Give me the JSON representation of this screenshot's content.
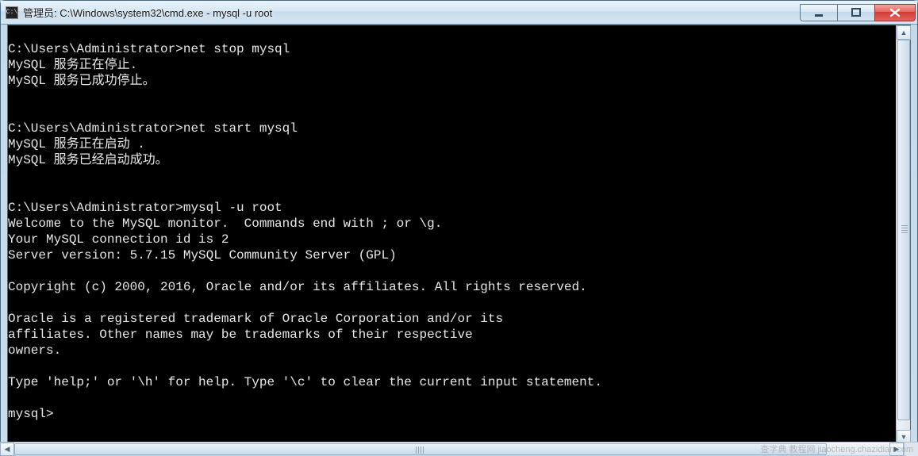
{
  "titlebar": {
    "icon_label": "C:\\",
    "text": "管理员: C:\\Windows\\system32\\cmd.exe - mysql  -u root"
  },
  "window_buttons": {
    "minimize": "minimize",
    "maximize": "maximize",
    "close": "close"
  },
  "terminal": {
    "lines": [
      "",
      "C:\\Users\\Administrator>net stop mysql",
      "MySQL 服务正在停止.",
      "MySQL 服务已成功停止。",
      "",
      "",
      "C:\\Users\\Administrator>net start mysql",
      "MySQL 服务正在启动 .",
      "MySQL 服务已经启动成功。",
      "",
      "",
      "C:\\Users\\Administrator>mysql -u root",
      "Welcome to the MySQL monitor.  Commands end with ; or \\g.",
      "Your MySQL connection id is 2",
      "Server version: 5.7.15 MySQL Community Server (GPL)",
      "",
      "Copyright (c) 2000, 2016, Oracle and/or its affiliates. All rights reserved.",
      "",
      "Oracle is a registered trademark of Oracle Corporation and/or its",
      "affiliates. Other names may be trademarks of their respective",
      "owners.",
      "",
      "Type 'help;' or '\\h' for help. Type '\\c' to clear the current input statement.",
      "",
      "mysql>"
    ],
    "current_prompt": "mysql>"
  },
  "watermark": "查字典  教程网  jiaocheng.chazidian.com"
}
